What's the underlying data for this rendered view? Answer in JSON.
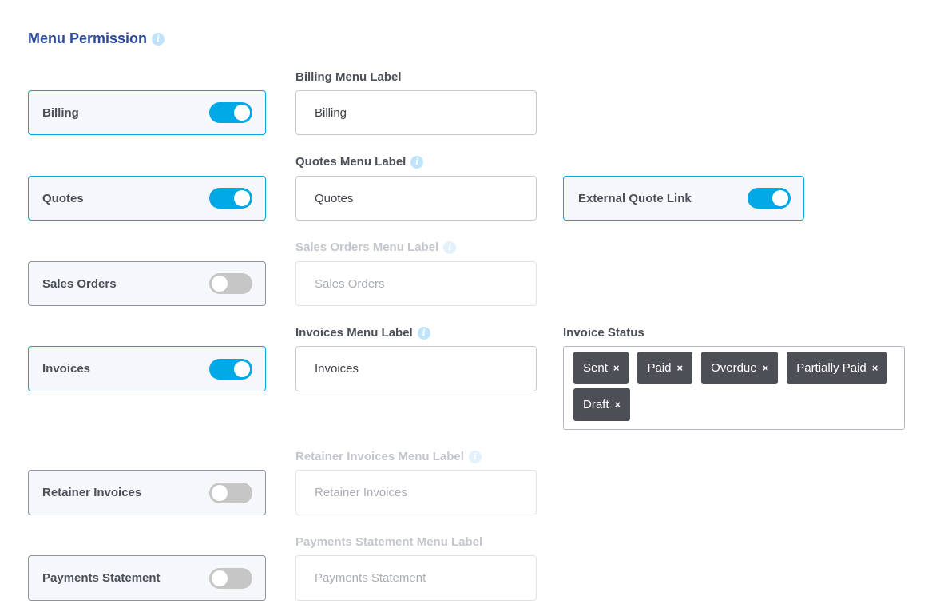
{
  "section": {
    "title": "Menu Permission",
    "info_glyph": "i"
  },
  "menus": [
    {
      "name": "Billing",
      "enabled": true,
      "label_title": "Billing Menu Label",
      "value": "Billing",
      "placeholder": "Billing"
    },
    {
      "name": "Quotes",
      "enabled": true,
      "label_title": "Quotes Menu Label",
      "value": "Quotes",
      "placeholder": "Quotes"
    },
    {
      "name": "Sales Orders",
      "enabled": false,
      "label_title": "Sales Orders Menu Label",
      "value": "",
      "placeholder": "Sales Orders"
    },
    {
      "name": "Invoices",
      "enabled": true,
      "label_title": "Invoices Menu Label",
      "value": "Invoices",
      "placeholder": "Invoices"
    },
    {
      "name": "Retainer Invoices",
      "enabled": false,
      "label_title": "Retainer Invoices Menu Label",
      "value": "",
      "placeholder": "Retainer Invoices"
    },
    {
      "name": "Payments Statement",
      "enabled": false,
      "label_title": "Payments Statement Menu Label",
      "value": "",
      "placeholder": "Payments Statement"
    }
  ],
  "external_quote": {
    "label": "External Quote Link",
    "enabled": true
  },
  "invoice_status": {
    "title": "Invoice Status",
    "remove_glyph": "×",
    "tags": [
      "Sent",
      "Paid",
      "Overdue",
      "Partially Paid",
      "Draft"
    ]
  },
  "colors": {
    "accent": "#00a9e6",
    "title": "#2e4a9c",
    "chip_bg": "#4c4f56",
    "toggle_off": "#c6c6c6"
  }
}
